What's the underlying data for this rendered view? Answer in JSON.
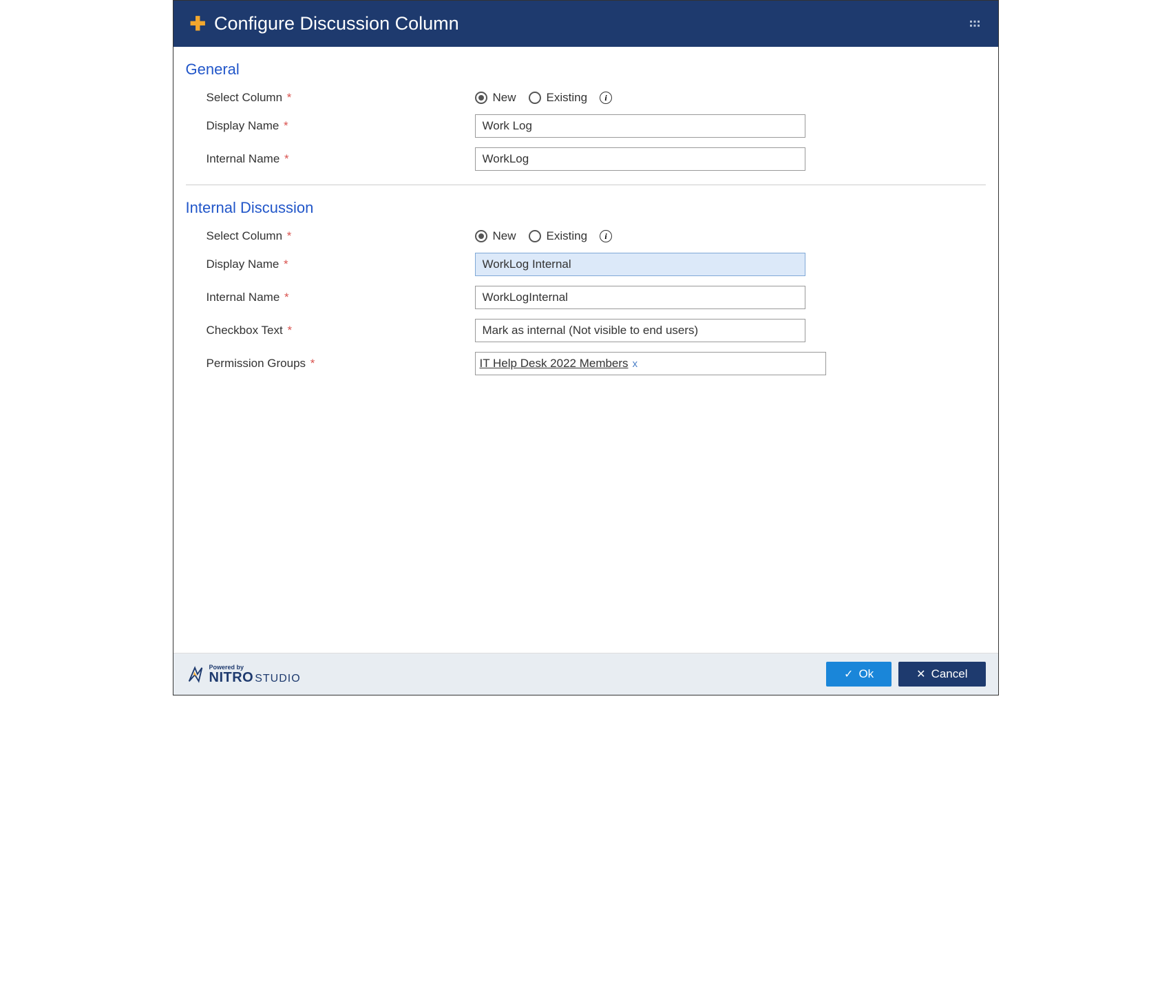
{
  "header": {
    "title": "Configure Discussion Column"
  },
  "sections": {
    "general": {
      "title": "General",
      "select_column_label": "Select Column",
      "radio_new": "New",
      "radio_existing": "Existing",
      "display_name_label": "Display Name",
      "display_name_value": "Work Log",
      "internal_name_label": "Internal Name",
      "internal_name_value": "WorkLog"
    },
    "internal_discussion": {
      "title": "Internal Discussion",
      "select_column_label": "Select Column",
      "radio_new": "New",
      "radio_existing": "Existing",
      "display_name_label": "Display Name",
      "display_name_value": "WorkLog Internal",
      "internal_name_label": "Internal Name",
      "internal_name_value": "WorkLogInternal",
      "checkbox_text_label": "Checkbox Text",
      "checkbox_text_value": "Mark as internal (Not visible to end users)",
      "permission_groups_label": "Permission Groups",
      "permission_groups_value": "IT Help Desk 2022 Members"
    }
  },
  "footer": {
    "powered_by": "Powered by",
    "brand_bold": "NITRO",
    "brand_light": "STUDIO",
    "ok_label": "Ok",
    "cancel_label": "Cancel"
  }
}
